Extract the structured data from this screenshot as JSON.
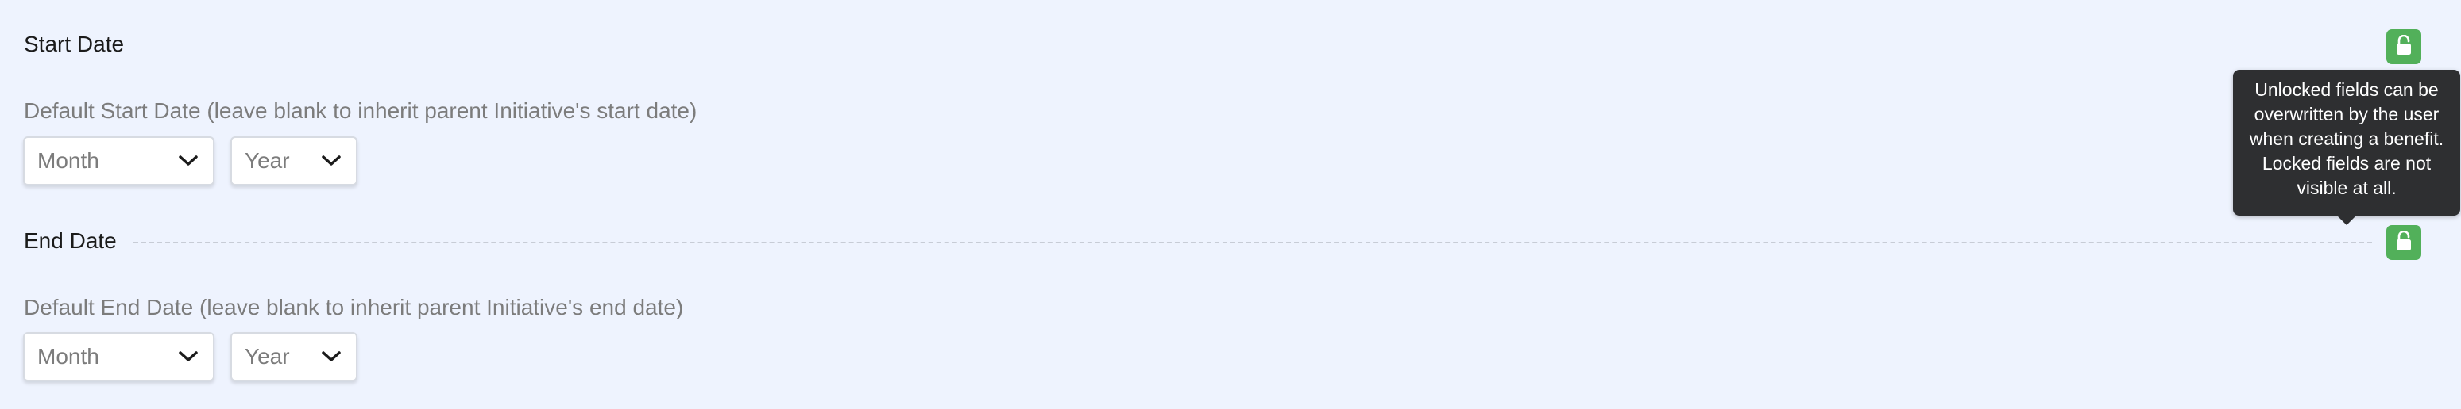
{
  "start_date": {
    "title": "Start Date",
    "hint": "Default Start Date (leave blank to inherit parent Initiative's start date)",
    "month_select": {
      "value": "Month"
    },
    "year_select": {
      "value": "Year"
    },
    "lock": {
      "icon": "unlock-icon",
      "state": "unlocked"
    }
  },
  "end_date": {
    "title": "End Date",
    "hint": "Default End Date (leave blank to inherit parent Initiative's end date)",
    "month_select": {
      "value": "Month"
    },
    "year_select": {
      "value": "Year"
    },
    "lock": {
      "icon": "unlock-icon",
      "state": "unlocked"
    }
  },
  "tooltip": {
    "lines": [
      "Unlocked fields can be",
      "overwritten by the user",
      "when creating a benefit.",
      "Locked fields are not",
      "visible at all."
    ]
  },
  "colors": {
    "background": "#eef3fe",
    "lock_button": "#52b05a",
    "tooltip_bg": "#2e2f31"
  }
}
